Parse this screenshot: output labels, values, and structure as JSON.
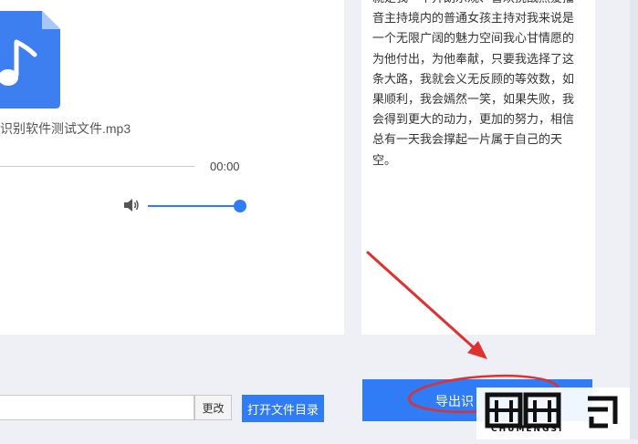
{
  "player": {
    "file_name": "识别软件测试文件.mp3",
    "time": "00:00",
    "volume_level": 1.0
  },
  "result": {
    "text": "就是我一个开朗乐观、喜欢挑战热爱播音主持境内的普通女孩主持对我来说是一个无限广阔的魅力空间我心甘情愿的为他付出，为他奉献，只要我选择了这条大路，我就会义无反顾的等效数，如果顺利，我会嫣然一笑，如果失败，我会得到更大的动力，更加的努力，相信总有一天我会撑起一片属于自己的天空。"
  },
  "footer": {
    "path_value": "",
    "change_label": "更改",
    "open_dir_label": "打开文件目录",
    "export_label": "导出识"
  },
  "watermark": {
    "text": "楚梦 司",
    "subtext": "CHUMENGSI"
  },
  "colors": {
    "accent": "#2f7cf6",
    "annotation": "#e03030"
  }
}
